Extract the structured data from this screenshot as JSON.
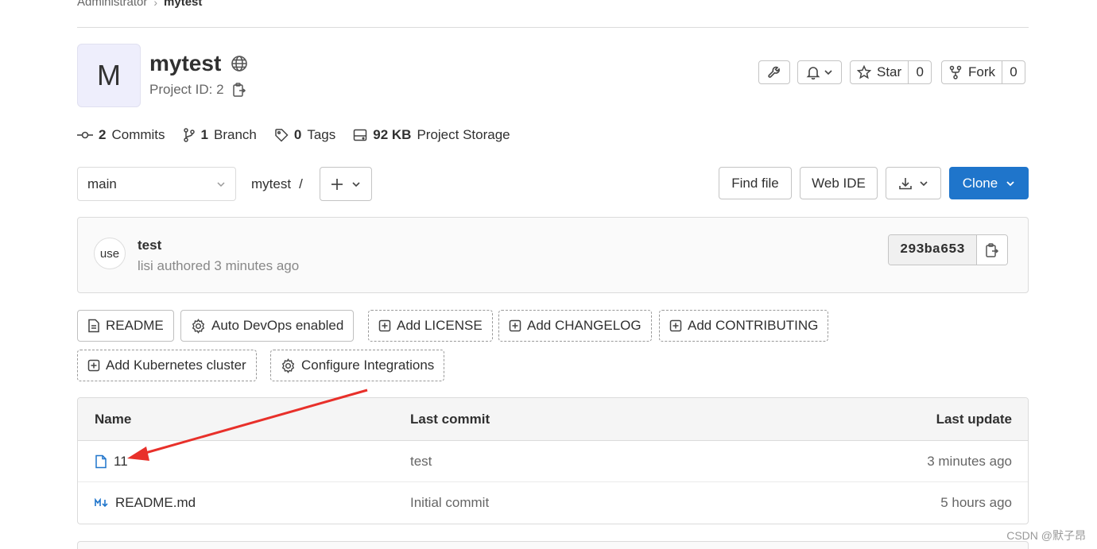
{
  "breadcrumb": {
    "parent": "Administrator",
    "current": "mytest"
  },
  "project": {
    "avatar_letter": "M",
    "name": "mytest",
    "id_label": "Project ID: 2"
  },
  "actions": {
    "star_label": "Star",
    "star_count": "0",
    "fork_label": "Fork",
    "fork_count": "0"
  },
  "stats": {
    "commits_count": "2",
    "commits_label": "Commits",
    "branch_count": "1",
    "branch_label": "Branch",
    "tags_count": "0",
    "tags_label": "Tags",
    "storage_size": "92 KB",
    "storage_label": "Project Storage"
  },
  "repo": {
    "branch": "main",
    "path_root": "mytest",
    "path_sep": "/",
    "find_file": "Find file",
    "web_ide": "Web IDE",
    "clone": "Clone"
  },
  "last_commit": {
    "avatar_text": "use",
    "title": "test",
    "subtitle": "lisi authored 3 minutes ago",
    "sha": "293ba653"
  },
  "quick_actions": [
    {
      "label": "README"
    },
    {
      "label": "Auto DevOps enabled"
    },
    {
      "label": "Add LICENSE"
    },
    {
      "label": "Add CHANGELOG"
    },
    {
      "label": "Add CONTRIBUTING"
    },
    {
      "label": "Add Kubernetes cluster"
    },
    {
      "label": "Configure Integrations"
    }
  ],
  "file_table": {
    "headers": {
      "name": "Name",
      "last_commit": "Last commit",
      "last_update": "Last update"
    },
    "rows": [
      {
        "name": "11",
        "commit": "test",
        "updated": "3 minutes ago",
        "icon": "file-icon"
      },
      {
        "name": "README.md",
        "commit": "Initial commit",
        "updated": "5 hours ago",
        "icon": "markdown-icon"
      }
    ]
  },
  "watermark": "CSDN @默子昂",
  "colors": {
    "primary": "#1f75cb",
    "annotation_arrow": "#e8302a"
  }
}
